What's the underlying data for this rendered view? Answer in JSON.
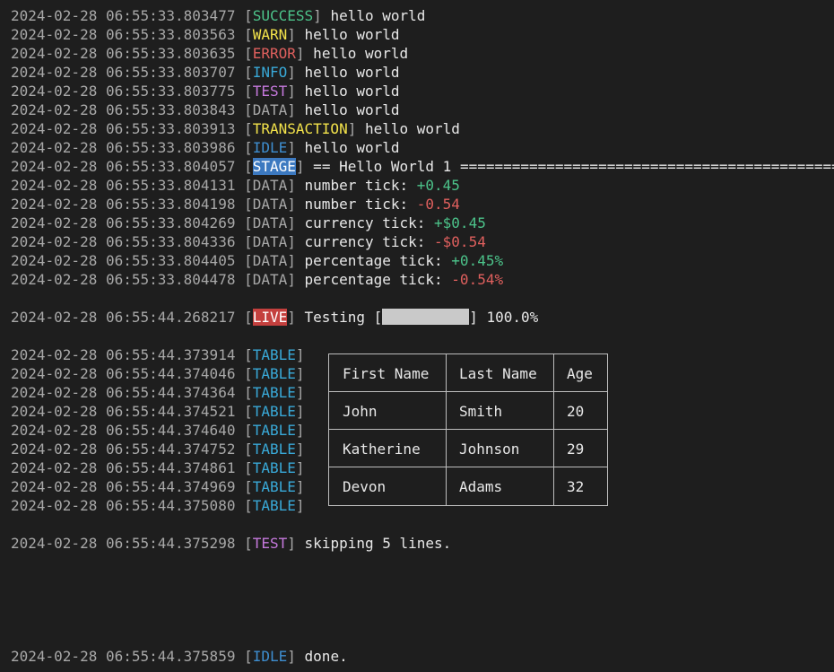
{
  "colors": {
    "SUCCESS": {
      "fg": "#4cc38a",
      "bg": "transparent"
    },
    "WARN": {
      "fg": "#f3e34b",
      "bg": "transparent"
    },
    "ERROR": {
      "fg": "#e0605e",
      "bg": "transparent"
    },
    "INFO": {
      "fg": "#39a9d8",
      "bg": "transparent"
    },
    "TEST": {
      "fg": "#c679dd",
      "bg": "transparent"
    },
    "DATA": {
      "fg": "#a8a8a8",
      "bg": "transparent"
    },
    "TRANSACTION": {
      "fg": "#f3e34b",
      "bg": "transparent"
    },
    "IDLE": {
      "fg": "#3e8ed0",
      "bg": "transparent"
    },
    "STAGE": {
      "fg": "#ffffff",
      "bg": "#3c79c0"
    },
    "LIVE": {
      "fg": "#ffffff",
      "bg": "#c4403e"
    },
    "TABLE": {
      "fg": "#39a9d8",
      "bg": "transparent"
    }
  },
  "lines": [
    {
      "ts": "2024-02-28 06:55:33.803477",
      "tag": "SUCCESS",
      "msg": " hello world"
    },
    {
      "ts": "2024-02-28 06:55:33.803563",
      "tag": "WARN",
      "msg": " hello world"
    },
    {
      "ts": "2024-02-28 06:55:33.803635",
      "tag": "ERROR",
      "msg": " hello world"
    },
    {
      "ts": "2024-02-28 06:55:33.803707",
      "tag": "INFO",
      "msg": " hello world"
    },
    {
      "ts": "2024-02-28 06:55:33.803775",
      "tag": "TEST",
      "msg": " hello world"
    },
    {
      "ts": "2024-02-28 06:55:33.803843",
      "tag": "DATA",
      "msg": " hello world"
    },
    {
      "ts": "2024-02-28 06:55:33.803913",
      "tag": "TRANSACTION",
      "msg": " hello world"
    },
    {
      "ts": "2024-02-28 06:55:33.803986",
      "tag": "IDLE",
      "msg": " hello world"
    },
    {
      "ts": "2024-02-28 06:55:33.804057",
      "tag": "STAGE",
      "msg": " == Hello World 1 ============================================"
    },
    {
      "ts": "2024-02-28 06:55:33.804131",
      "tag": "DATA",
      "msg": " number tick: ",
      "val": "+0.45",
      "sign": "pos"
    },
    {
      "ts": "2024-02-28 06:55:33.804198",
      "tag": "DATA",
      "msg": " number tick: ",
      "val": "-0.54",
      "sign": "neg"
    },
    {
      "ts": "2024-02-28 06:55:33.804269",
      "tag": "DATA",
      "msg": " currency tick: ",
      "val": "+$0.45",
      "sign": "pos"
    },
    {
      "ts": "2024-02-28 06:55:33.804336",
      "tag": "DATA",
      "msg": " currency tick: ",
      "val": "-$0.54",
      "sign": "neg"
    },
    {
      "ts": "2024-02-28 06:55:33.804405",
      "tag": "DATA",
      "msg": " percentage tick: ",
      "val": "+0.45%",
      "sign": "pos"
    },
    {
      "ts": "2024-02-28 06:55:33.804478",
      "tag": "DATA",
      "msg": " percentage tick: ",
      "val": "-0.54%",
      "sign": "neg"
    },
    {
      "blank": true
    },
    {
      "ts": "2024-02-28 06:55:44.268217",
      "tag": "LIVE",
      "msg": " Testing [",
      "progress": 1.0,
      "after": "] 100.0%"
    },
    {
      "blank": true
    },
    {
      "ts": "2024-02-28 06:55:44.373914",
      "tag": "TABLE",
      "msg": ""
    },
    {
      "ts": "2024-02-28 06:55:44.374046",
      "tag": "TABLE",
      "msg": ""
    },
    {
      "ts": "2024-02-28 06:55:44.374364",
      "tag": "TABLE",
      "msg": ""
    },
    {
      "ts": "2024-02-28 06:55:44.374521",
      "tag": "TABLE",
      "msg": ""
    },
    {
      "ts": "2024-02-28 06:55:44.374640",
      "tag": "TABLE",
      "msg": ""
    },
    {
      "ts": "2024-02-28 06:55:44.374752",
      "tag": "TABLE",
      "msg": ""
    },
    {
      "ts": "2024-02-28 06:55:44.374861",
      "tag": "TABLE",
      "msg": ""
    },
    {
      "ts": "2024-02-28 06:55:44.374969",
      "tag": "TABLE",
      "msg": ""
    },
    {
      "ts": "2024-02-28 06:55:44.375080",
      "tag": "TABLE",
      "msg": ""
    },
    {
      "blank": true
    },
    {
      "ts": "2024-02-28 06:55:44.375298",
      "tag": "TEST",
      "msg": " skipping 5 lines."
    },
    {
      "blank": true
    },
    {
      "blank": true
    },
    {
      "blank": true
    },
    {
      "blank": true
    },
    {
      "blank": true
    },
    {
      "ts": "2024-02-28 06:55:44.375859",
      "tag": "IDLE",
      "msg": " done."
    }
  ],
  "table": {
    "headers": [
      "First Name",
      "Last Name",
      "Age"
    ],
    "rows": [
      [
        "John",
        "Smith",
        "20"
      ],
      [
        "Katherine",
        "Johnson",
        "29"
      ],
      [
        "Devon",
        "Adams",
        "32"
      ]
    ]
  }
}
